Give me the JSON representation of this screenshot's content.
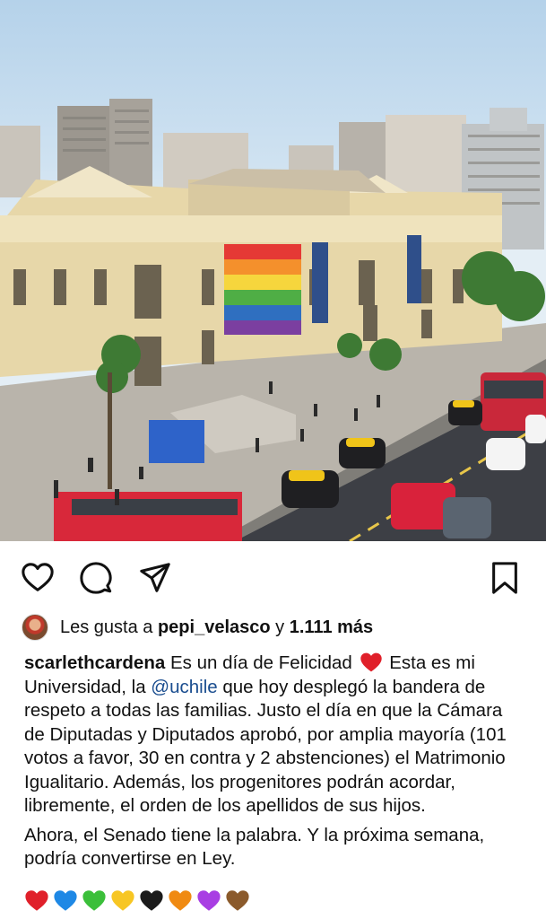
{
  "photo": {
    "description_icon": "photo",
    "flag_colors": [
      "#e53935",
      "#f4902c",
      "#f6d63d",
      "#4fae45",
      "#2f6fc0",
      "#7b3fa0"
    ]
  },
  "actions": {
    "like_icon": "heart-outline-icon",
    "comment_icon": "comment-bubble-icon",
    "share_icon": "paper-plane-icon",
    "save_icon": "bookmark-icon"
  },
  "likes": {
    "prefix": "Les gusta a ",
    "user": "pepi_velasco",
    "middle": " y ",
    "count": "1.111 más"
  },
  "caption": {
    "username": "scarlethcardena",
    "text_a": " Es un día de Felicidad ",
    "text_b": " Esta es mi Universidad, la ",
    "mention": "@uchile",
    "text_c": " que hoy desplegó la bandera de respeto a todas las familias. Justo el día en que la Cámara de Diputadas y Diputados aprobó, por amplia mayoría (101 votos a favor, 30 en contra y 2 abstenciones) el Matrimonio Igualitario. Además, los progenitores podrán acordar, libremente, el orden de los apellidos de sus hijos.",
    "paragraph2": "Ahora, el Senado tiene la palabra. Y la próxima semana, podría convertirse en Ley."
  },
  "hearts": [
    "#e0202a",
    "#1e88e5",
    "#3bbf3a",
    "#f7c623",
    "#1b1b1b",
    "#f08a12",
    "#a83ee3",
    "#8b5a2b"
  ]
}
